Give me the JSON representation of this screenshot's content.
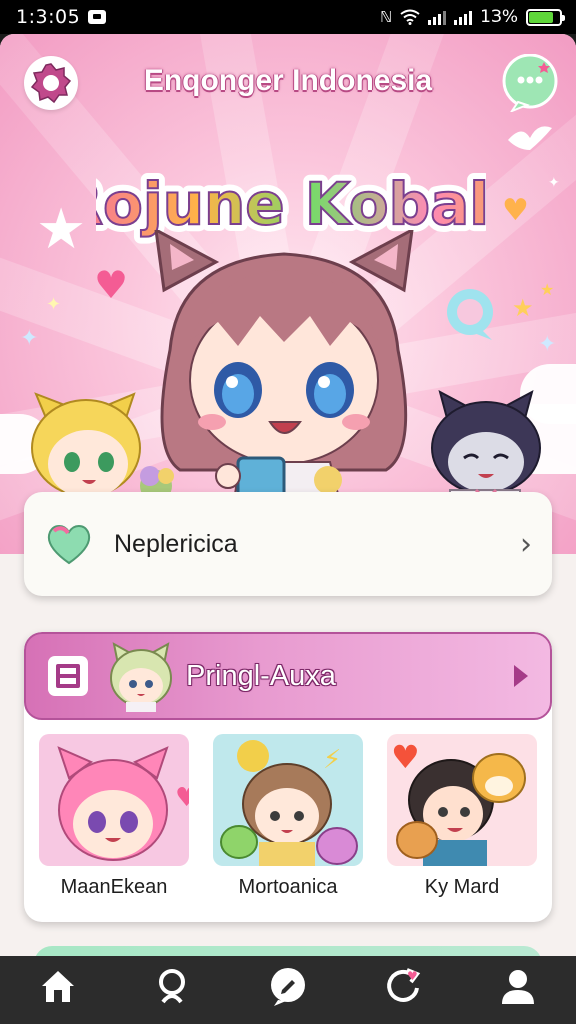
{
  "status_bar": {
    "time": "1:3:05",
    "battery_text": "1З%",
    "battery_level": 0.8,
    "battery_color": "#5fd63a"
  },
  "header": {
    "title": "Enqonger Indonesia",
    "logo_text": "Rojune Kobals",
    "settings_icon": "gear-icon",
    "chat_icon": "chat-bubble-icon"
  },
  "search": {
    "text": "Neplericica",
    "icon": "heart-icon"
  },
  "section": {
    "title": "Pringl-Auxa",
    "icon": "grid-icon",
    "items": [
      {
        "label": "MaanEkean",
        "bg": "#f7c8e2"
      },
      {
        "label": "Mortoanica",
        "bg": "#bfe8ec"
      },
      {
        "label": "Ky Mard",
        "bg": "#fde0e6"
      }
    ]
  },
  "bottom_nav": {
    "items": [
      {
        "icon": "home-icon"
      },
      {
        "icon": "search-icon"
      },
      {
        "icon": "chat-icon"
      },
      {
        "icon": "refresh-icon"
      },
      {
        "icon": "profile-icon"
      }
    ]
  },
  "colors": {
    "accent": "#d671b6",
    "hero_bg": "#f29cc3",
    "nav_bg": "#2c2c2c"
  }
}
